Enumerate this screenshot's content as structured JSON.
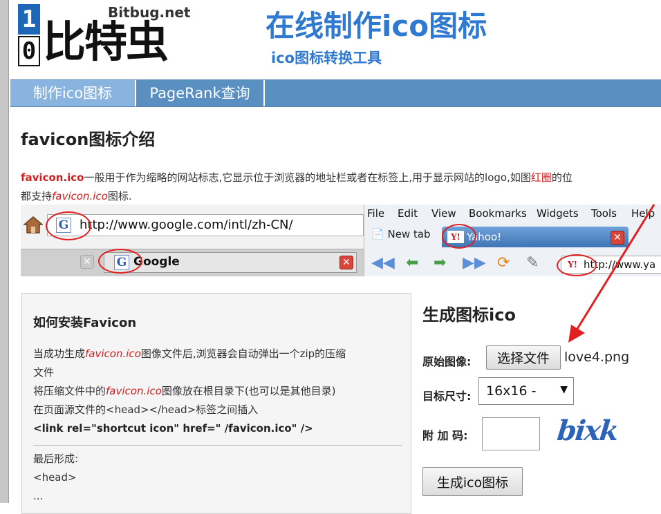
{
  "header": {
    "logo_digit_top": "1",
    "logo_digit_bottom": "0",
    "logo_domain": "Bitbug.net",
    "logo_name": "比特虫",
    "site_title": "在线制作ico图标",
    "site_subtitle": "ico图标转换工具"
  },
  "nav": {
    "tabs": [
      {
        "label": "制作ico图标",
        "active": true
      },
      {
        "label": "PageRank查询",
        "active": false
      }
    ]
  },
  "intro": {
    "title": "favicon图标介绍",
    "p1_brand": "favicon.ico",
    "p1_text": "一般用于作为缩略的网站标志,它显示位于浏览器的地址栏或者在标签上,用于显示网站的logo,如图",
    "p1_red_word": "红圈",
    "p1_tail": "的位",
    "p2_pre": "都支持",
    "p2_italic": "favicon.ico",
    "p2_post": "图标."
  },
  "screenshot": {
    "google_url": "http://www.google.com/intl/zh-CN/",
    "google_tab": "Google",
    "g_letter": "G",
    "menu": [
      "File",
      "Edit",
      "View",
      "Bookmarks",
      "Widgets",
      "Tools",
      "Help"
    ],
    "new_tab": "New tab",
    "yahoo_tab": "Yahoo!",
    "yahoo_icon": "Y!",
    "yahoo_url": "http://www.ya"
  },
  "help": {
    "title": "如何安装Favicon",
    "l1_pre": "当成功生成",
    "l1_italic": "favicon.ico",
    "l1_post": "图像文件后,浏览器会自动弹出一个zip的压缩",
    "l1_wrap": "文件",
    "l2_pre": "将压缩文件中的",
    "l2_italic": "favicon.ico",
    "l2_post": "图像放在根目录下(也可以是其他目录)",
    "l3": "在页面源文件的<head></head>标签之间插入",
    "code": "<link rel=\"shortcut icon\" href=\" /favicon.ico\" />",
    "final_label": "最后形成:",
    "final_head": "<head>",
    "final_more": "..."
  },
  "generator": {
    "title": "生成图标ico",
    "source_label": "原始图像:",
    "choose_button": "选择文件",
    "file_name": "love4.png",
    "size_label": "目标尺寸:",
    "size_value": "16x16 -",
    "code_label": "附 加 码:",
    "code_value": "",
    "captcha_text": "bixk",
    "submit_button": "生成ico图标"
  },
  "colors": {
    "accent_blue": "#2f7ad0",
    "nav_blue": "#5a8fc2",
    "nav_active": "#89b4df",
    "highlight_red": "#d21e1e"
  }
}
